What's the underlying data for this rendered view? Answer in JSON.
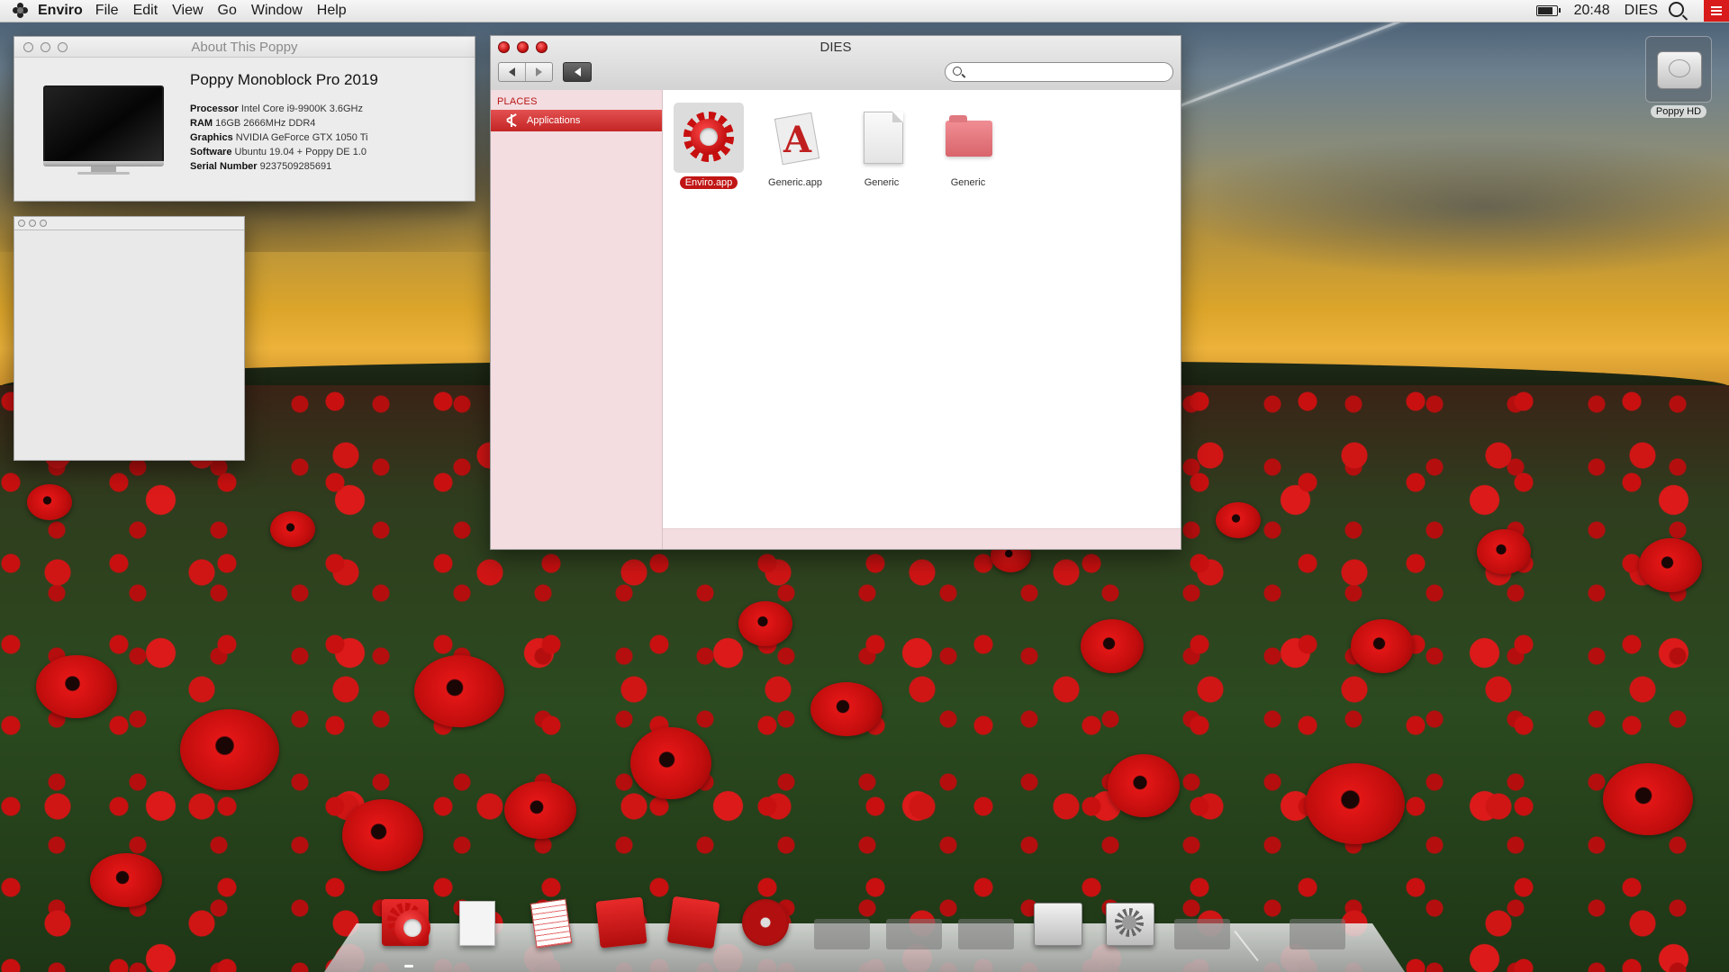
{
  "menubar": {
    "app_name": "Enviro",
    "menus": [
      "File",
      "Edit",
      "View",
      "Go",
      "Window",
      "Help"
    ],
    "clock": "20:48",
    "user": "DIES"
  },
  "about_window": {
    "title": "About This Poppy",
    "model": "Poppy Monoblock Pro 2019",
    "specs": [
      {
        "label": "Processor",
        "value": "Intel Core i9-9900K 3.6GHz"
      },
      {
        "label": "RAM",
        "value": "16GB 2666MHz DDR4"
      },
      {
        "label": "Graphics",
        "value": "NVIDIA GeForce GTX 1050 Ti"
      },
      {
        "label": "Software",
        "value": "Ubuntu 19.04 + Poppy DE 1.0"
      },
      {
        "label": "Serial Number",
        "value": "9237509285691"
      }
    ]
  },
  "finder": {
    "title": "DIES",
    "search_value": "",
    "sidebar": {
      "section": "PLACES",
      "items": [
        {
          "label": "Applications",
          "selected": true
        }
      ]
    },
    "files": [
      {
        "label": "Enviro.app",
        "icon": "gear-icon",
        "selected": true
      },
      {
        "label": "Generic.app",
        "icon": "generic-app-icon",
        "selected": false
      },
      {
        "label": "Generic",
        "icon": "document-icon",
        "selected": false
      },
      {
        "label": "Generic",
        "icon": "folder-icon",
        "selected": false
      }
    ]
  },
  "desktop": {
    "disk_label": "Poppy HD"
  },
  "dock": {
    "items": [
      "enviro-app-icon",
      "text-editor-icon",
      "notes-icon",
      "mail-icon",
      "developer-tools-icon",
      "music-player-icon",
      "archive-utility-icon",
      "system-preferences-icon"
    ],
    "accent": "#c11515"
  }
}
